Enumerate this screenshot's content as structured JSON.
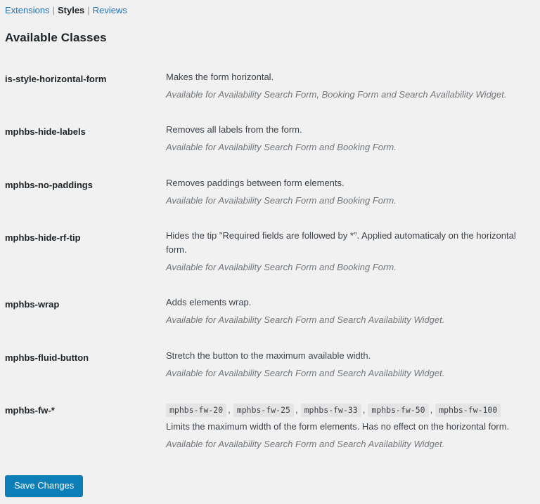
{
  "subnav": {
    "items": [
      {
        "label": "Extensions",
        "current": false
      },
      {
        "label": "Styles",
        "current": true
      },
      {
        "label": "Reviews",
        "current": false
      }
    ],
    "separator": "|"
  },
  "heading": "Available Classes",
  "table": {
    "rows": [
      {
        "class_name": "is-style-horizontal-form",
        "description": "Makes the form horizontal.",
        "availability": "Available for Availability Search Form, Booking Form and Search Availability Widget."
      },
      {
        "class_name": "mphbs-hide-labels",
        "description": "Removes all labels from the form.",
        "availability": "Available for Availability Search Form and Booking Form."
      },
      {
        "class_name": "mphbs-no-paddings",
        "description": "Removes paddings between form elements.",
        "availability": "Available for Availability Search Form and Booking Form."
      },
      {
        "class_name": "mphbs-hide-rf-tip",
        "description": "Hides the tip \"Required fields are followed by *\". Applied automaticaly on the horizontal form.",
        "availability": "Available for Availability Search Form and Booking Form."
      },
      {
        "class_name": "mphbs-wrap",
        "description": "Adds elements wrap.",
        "availability": "Available for Availability Search Form and Search Availability Widget."
      },
      {
        "class_name": "mphbs-fluid-button",
        "description": "Stretch the button to the maximum available width.",
        "availability": "Available for Availability Search Form and Search Availability Widget."
      },
      {
        "class_name": "mphbs-fw-*",
        "variants": [
          "mphbs-fw-20",
          "mphbs-fw-25",
          "mphbs-fw-33",
          "mphbs-fw-50",
          "mphbs-fw-100"
        ],
        "variant_separator": ",",
        "description": "Limits the maximum width of the form elements. Has no effect on the horizontal form.",
        "availability": "Available for Availability Search Form and Search Availability Widget."
      }
    ]
  },
  "submit": {
    "save_label": "Save Changes"
  },
  "colors": {
    "page_background": "#f1f1f1",
    "link": "#2271b1",
    "heading_text": "#1d2327",
    "body_text": "#3c434a",
    "muted_italic_text": "#72777c",
    "chip_background": "#e4e4e4",
    "primary_button": "#0e7eb8"
  }
}
